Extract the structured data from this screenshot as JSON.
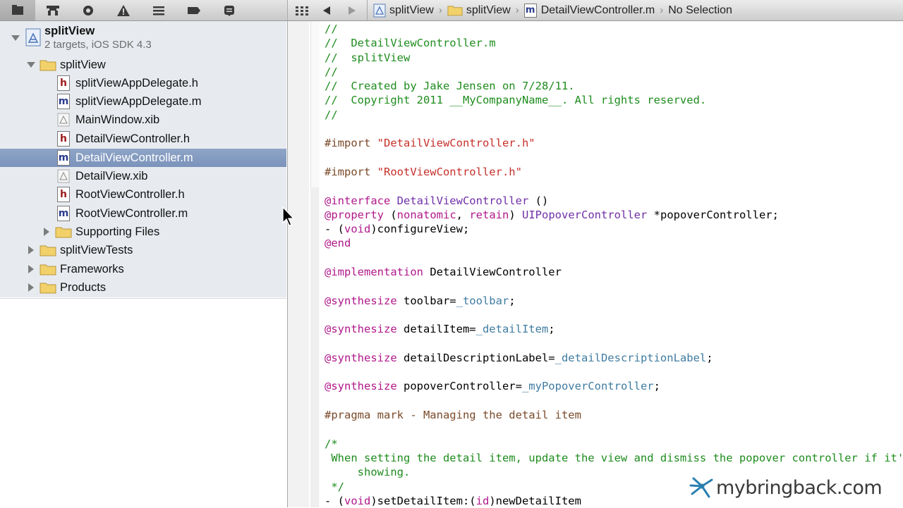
{
  "navigator": {
    "toolbar_icons": [
      "project-navigator-icon",
      "hierarchy-icon",
      "search-navigator-icon",
      "issue-warning-icon",
      "debug-list-icon",
      "breakpoint-icon",
      "log-icon"
    ],
    "project": {
      "name": "splitView",
      "subtitle": "2 targets, iOS SDK 4.3"
    },
    "tree": [
      {
        "label": "splitView",
        "type": "folder",
        "expanded": true,
        "level": 1
      },
      {
        "label": "splitViewAppDelegate.h",
        "type": "h",
        "level": 2
      },
      {
        "label": "splitViewAppDelegate.m",
        "type": "m",
        "level": 2
      },
      {
        "label": "MainWindow.xib",
        "type": "xib",
        "level": 2
      },
      {
        "label": "DetailViewController.h",
        "type": "h",
        "level": 2
      },
      {
        "label": "DetailViewController.m",
        "type": "m",
        "level": 2,
        "selected": true
      },
      {
        "label": "DetailView.xib",
        "type": "xib",
        "level": 2
      },
      {
        "label": "RootViewController.h",
        "type": "h",
        "level": 2
      },
      {
        "label": "RootViewController.m",
        "type": "m",
        "level": 2
      },
      {
        "label": "Supporting Files",
        "type": "folder",
        "expanded": false,
        "level": 2
      },
      {
        "label": "splitViewTests",
        "type": "folder",
        "expanded": false,
        "level": 1
      },
      {
        "label": "Frameworks",
        "type": "folder",
        "expanded": false,
        "level": 1
      },
      {
        "label": "Products",
        "type": "folder",
        "expanded": false,
        "level": 1
      }
    ]
  },
  "jump_bar": {
    "crumbs": [
      "splitView",
      "splitView",
      "DetailViewController.m",
      "No Selection"
    ]
  },
  "editor": {
    "lines": [
      [
        {
          "t": "//",
          "c": "comment"
        }
      ],
      [
        {
          "t": "//  DetailViewController.m",
          "c": "comment"
        }
      ],
      [
        {
          "t": "//  splitView",
          "c": "comment"
        }
      ],
      [
        {
          "t": "//",
          "c": "comment"
        }
      ],
      [
        {
          "t": "//  Created by Jake Jensen on 7/28/11.",
          "c": "comment"
        }
      ],
      [
        {
          "t": "//  Copyright 2011 __MyCompanyName__. All rights reserved.",
          "c": "comment"
        }
      ],
      [
        {
          "t": "//",
          "c": "comment"
        }
      ],
      [],
      [
        {
          "t": "#import ",
          "c": "directive"
        },
        {
          "t": "\"DetailViewController.h\"",
          "c": "string"
        }
      ],
      [],
      [
        {
          "t": "#import ",
          "c": "directive"
        },
        {
          "t": "\"RootViewController.h\"",
          "c": "string"
        }
      ],
      [],
      [
        {
          "t": "@interface ",
          "c": "keyword"
        },
        {
          "t": "DetailViewController",
          "c": "class"
        },
        {
          "t": " ()",
          "c": "plain"
        }
      ],
      [
        {
          "t": "@property ",
          "c": "keyword"
        },
        {
          "t": "(",
          "c": "plain"
        },
        {
          "t": "nonatomic",
          "c": "keyword"
        },
        {
          "t": ", ",
          "c": "plain"
        },
        {
          "t": "retain",
          "c": "keyword"
        },
        {
          "t": ") ",
          "c": "plain"
        },
        {
          "t": "UIPopoverController",
          "c": "class"
        },
        {
          "t": " *popoverController;",
          "c": "plain"
        }
      ],
      [
        {
          "t": "- (",
          "c": "plain"
        },
        {
          "t": "void",
          "c": "keyword"
        },
        {
          "t": ")configureView;",
          "c": "plain"
        }
      ],
      [
        {
          "t": "@end",
          "c": "keyword"
        }
      ],
      [],
      [
        {
          "t": "@implementation ",
          "c": "keyword"
        },
        {
          "t": "DetailViewController",
          "c": "plain"
        }
      ],
      [],
      [
        {
          "t": "@synthesize ",
          "c": "keyword"
        },
        {
          "t": "toolbar=",
          "c": "plain"
        },
        {
          "t": "_toolbar",
          "c": "ivar"
        },
        {
          "t": ";",
          "c": "plain"
        }
      ],
      [],
      [
        {
          "t": "@synthesize ",
          "c": "keyword"
        },
        {
          "t": "detailItem=",
          "c": "plain"
        },
        {
          "t": "_detailItem",
          "c": "ivar"
        },
        {
          "t": ";",
          "c": "plain"
        }
      ],
      [],
      [
        {
          "t": "@synthesize ",
          "c": "keyword"
        },
        {
          "t": "detailDescriptionLabel=",
          "c": "plain"
        },
        {
          "t": "_detailDescriptionLabel",
          "c": "ivar"
        },
        {
          "t": ";",
          "c": "plain"
        }
      ],
      [],
      [
        {
          "t": "@synthesize ",
          "c": "keyword"
        },
        {
          "t": "popoverController=",
          "c": "plain"
        },
        {
          "t": "_myPopoverController",
          "c": "ivar"
        },
        {
          "t": ";",
          "c": "plain"
        }
      ],
      [],
      [
        {
          "t": "#pragma mark - Managing the detail item",
          "c": "directive"
        }
      ],
      [],
      [
        {
          "t": "/*",
          "c": "comment"
        }
      ],
      [
        {
          "t": " When setting the detail item, update the view and dismiss the popover controller if it's",
          "c": "comment"
        }
      ],
      [
        {
          "t": "     showing.",
          "c": "comment"
        }
      ],
      [
        {
          "t": " */",
          "c": "comment"
        }
      ],
      [
        {
          "t": "- (",
          "c": "plain"
        },
        {
          "t": "void",
          "c": "keyword"
        },
        {
          "t": ")setDetailItem:(",
          "c": "plain"
        },
        {
          "t": "id",
          "c": "keyword"
        },
        {
          "t": ")newDetailItem",
          "c": "plain"
        }
      ]
    ]
  },
  "watermark": {
    "text": "mybringback.com"
  },
  "colors": {
    "selection": "#7b93bb",
    "comment": "#1e8c1e",
    "string": "#c6302b",
    "keyword": "#b0178a",
    "class": "#6f2fa8",
    "ivar": "#3f7ba0"
  }
}
